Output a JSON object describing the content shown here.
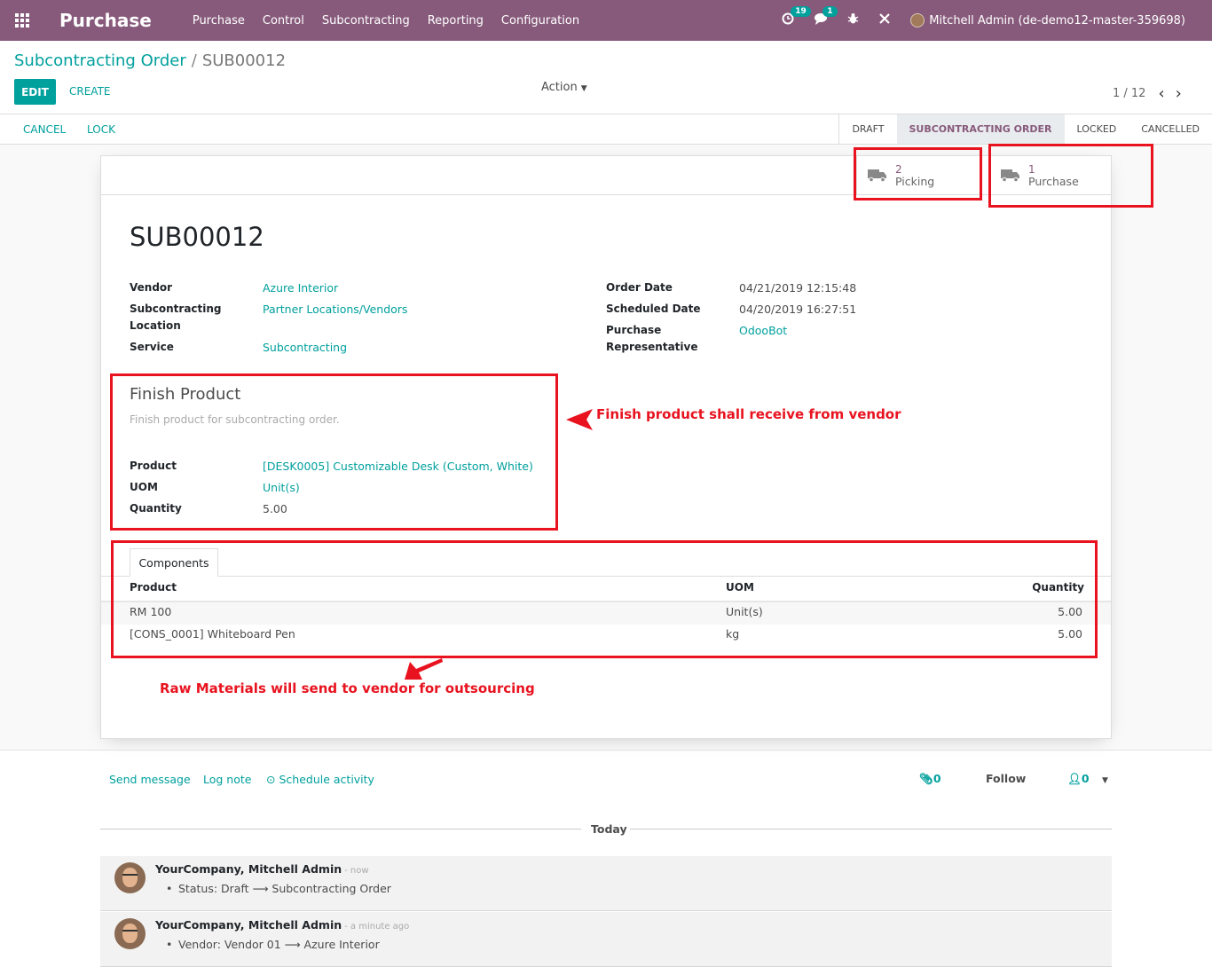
{
  "navbar": {
    "app_name": "Purchase",
    "menu": [
      "Purchase",
      "Control",
      "Subcontracting",
      "Reporting",
      "Configuration"
    ],
    "activity_count": "19",
    "message_count": "1",
    "user": "Mitchell Admin (de-demo12-master-359698)"
  },
  "breadcrumb": {
    "parent": "Subcontracting Order",
    "separator": "/",
    "current": "SUB00012"
  },
  "controls": {
    "edit": "EDIT",
    "create": "CREATE",
    "action": "Action",
    "pager": "1 / 12"
  },
  "statusbar": {
    "buttons": [
      "CANCEL",
      "LOCK"
    ],
    "stages": [
      "DRAFT",
      "SUBCONTRACTING ORDER",
      "LOCKED",
      "CANCELLED"
    ],
    "active_stage": "SUBCONTRACTING ORDER"
  },
  "smart_buttons": [
    {
      "value": "2",
      "label": "Picking",
      "icon": "truck-icon"
    },
    {
      "value": "1",
      "label": "Purchase",
      "icon": "truck-icon"
    }
  ],
  "record": {
    "name": "SUB00012",
    "left_fields": [
      {
        "label": "Vendor",
        "value": "Azure Interior"
      },
      {
        "label": "Subcontracting Location",
        "value": "Partner Locations/Vendors"
      },
      {
        "label": "Service",
        "value": "Subcontracting"
      }
    ],
    "right_fields": [
      {
        "label": "Order Date",
        "value": "04/21/2019 12:15:48"
      },
      {
        "label": "Scheduled Date",
        "value": "04/20/2019 16:27:51"
      },
      {
        "label": "Purchase Representative",
        "value": "OdooBot"
      }
    ]
  },
  "finish_product": {
    "title": "Finish Product",
    "subtitle": "Finish product for subcontracting order.",
    "fields": [
      {
        "label": "Product",
        "value": "[DESK0005] Customizable Desk (Custom, White)"
      },
      {
        "label": "UOM",
        "value": "Unit(s)"
      },
      {
        "label": "Quantity",
        "value": "5.00"
      }
    ]
  },
  "components": {
    "tab": "Components",
    "columns": [
      "Product",
      "UOM",
      "Quantity"
    ],
    "rows": [
      {
        "product": "RM 100",
        "uom": "Unit(s)",
        "quantity": "5.00"
      },
      {
        "product": "[CONS_0001] Whiteboard Pen",
        "uom": "kg",
        "quantity": "5.00"
      }
    ]
  },
  "annotations": {
    "finish_note": "Finish product shall receive from vendor",
    "raw_note": "Raw Materials will send to vendor for outsourcing",
    "color": "#e8131f"
  },
  "chatter": {
    "send_message": "Send message",
    "log_note": "Log note",
    "schedule_activity": "Schedule activity",
    "attachments": "0",
    "follow": "Follow",
    "followers": "0",
    "today": "Today",
    "messages": [
      {
        "author": "YourCompany, Mitchell Admin",
        "time": "- now",
        "body": "Status: Draft ⟶ Subcontracting Order"
      },
      {
        "author": "YourCompany, Mitchell Admin",
        "time": "- a minute ago",
        "body": "Vendor: Vendor 01 ⟶ Azure Interior"
      }
    ]
  },
  "colors": {
    "brand": "#875a7b",
    "accent": "#00a09d"
  }
}
